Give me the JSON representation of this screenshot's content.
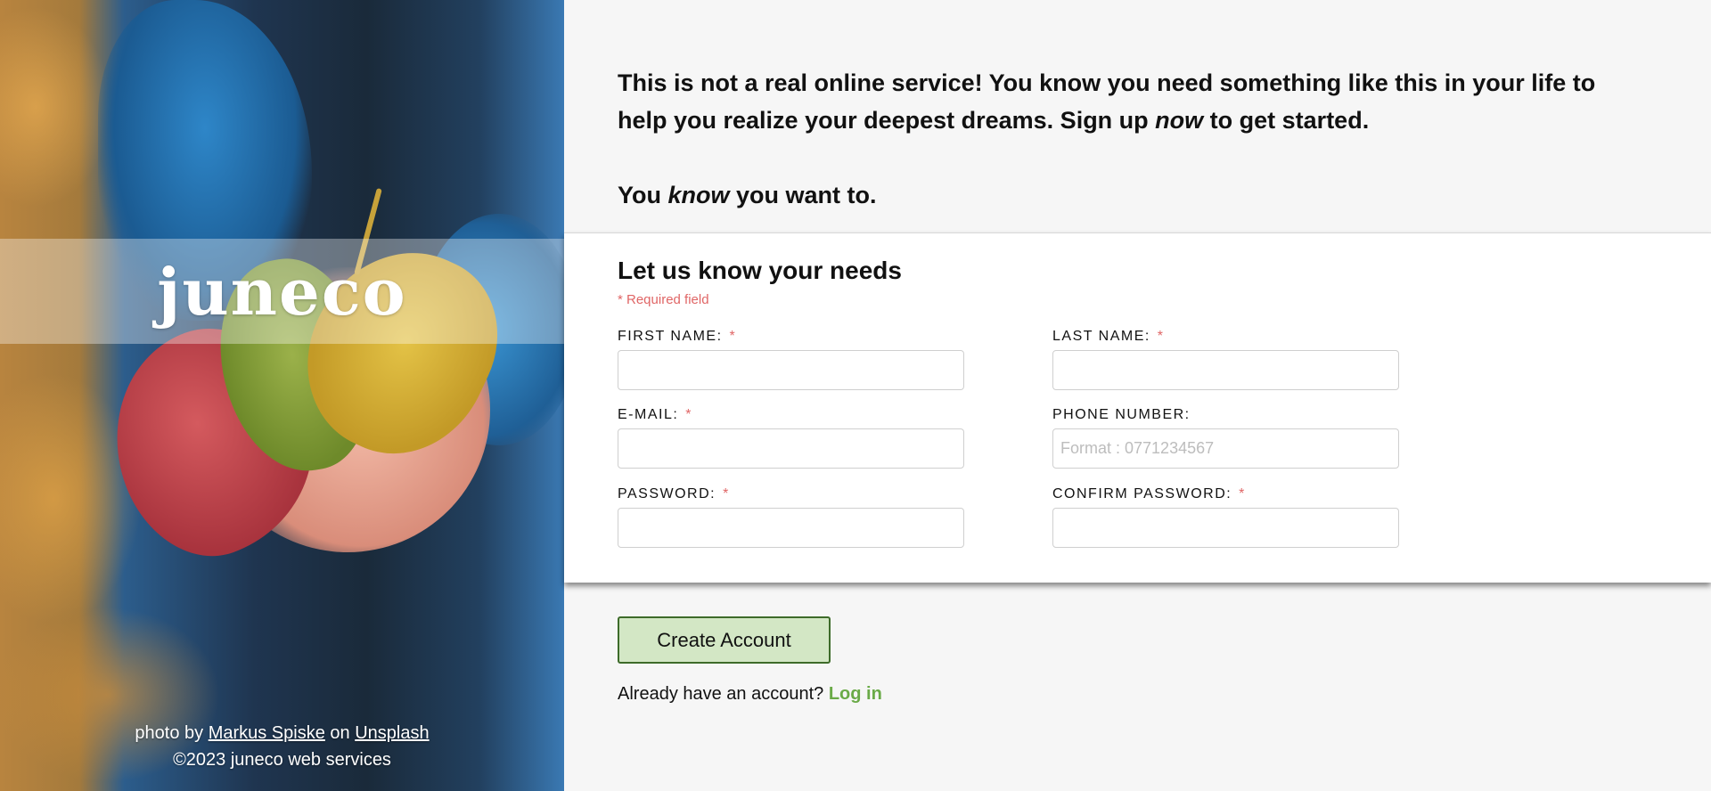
{
  "hero": {
    "logo": "juneco",
    "credit_prefix": "photo by",
    "photographer": "Markus Spiske",
    "credit_on": "on",
    "source": "Unsplash",
    "copyright": "©2023 juneco web services"
  },
  "intro": {
    "line1_part1": "This is not a real online service! You know you need something like this in your life to help you realize your deepest dreams. Sign up ",
    "line1_em": "now",
    "line1_part2": " to get started.",
    "line2_part1": "You ",
    "line2_em": "know",
    "line2_part2": " you want to."
  },
  "form": {
    "title": "Let us know your needs",
    "required_note": "* Required field",
    "required_marker": "*",
    "fields": {
      "first_name": {
        "label": "FIRST NAME:",
        "value": "",
        "placeholder": ""
      },
      "last_name": {
        "label": "LAST NAME:",
        "value": "",
        "placeholder": ""
      },
      "email": {
        "label": "E-MAIL:",
        "value": "",
        "placeholder": ""
      },
      "phone": {
        "label": "PHONE NUMBER:",
        "value": "",
        "placeholder": "Format : 0771234567"
      },
      "password": {
        "label": "PASSWORD:",
        "value": "",
        "placeholder": ""
      },
      "confirm_password": {
        "label": "CONFIRM PASSWORD:",
        "value": "",
        "placeholder": ""
      }
    }
  },
  "actions": {
    "create_account": "Create Account",
    "login_prompt": "Already have an account?",
    "login_link": "Log in"
  },
  "colors": {
    "accent_green": "#6aaa47",
    "button_bg": "#d3e7c5",
    "button_border": "#3d6b2a",
    "required_red": "#e06666"
  }
}
